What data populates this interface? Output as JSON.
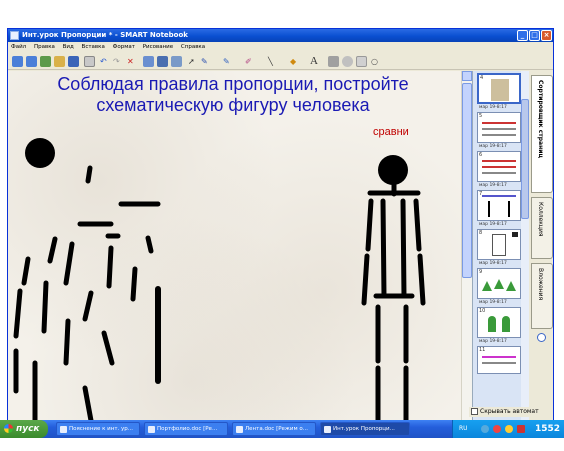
{
  "window": {
    "title": "Инт.урок Пропорции * - SMART Notebook",
    "controls": {
      "minimize": "_",
      "maximize": "□",
      "close": "×"
    }
  },
  "menu": [
    "Файл",
    "Правка",
    "Вид",
    "Вставка",
    "Формат",
    "Рисование",
    "Справка"
  ],
  "toolbar": {
    "icons": [
      "back-icon",
      "forward-icon",
      "add-page-icon",
      "open-icon",
      "save-icon",
      "paste-icon",
      "undo-icon",
      "redo-icon",
      "delete-icon",
      "screen-shade-icon",
      "table-icon",
      "capture-icon",
      "select-icon",
      "pen-icon",
      "creative-pen-icon",
      "eraser-icon",
      "line-icon",
      "fill-icon",
      "text-icon",
      "properties-icon",
      "move-icon",
      "more-icon"
    ]
  },
  "canvas": {
    "heading_line1": "Соблюдая правила пропорции, постройте",
    "heading_line2": "схематическую фигуру человека",
    "compare_label": "сравни",
    "colors": {
      "heading": "#1a1ab4",
      "compare": "#c00000",
      "stroke": "#000000",
      "arrow": "#b01010"
    }
  },
  "sidebar": {
    "thumbnails": [
      {
        "num": "4",
        "date": "мар 19-8:17",
        "selected": true
      },
      {
        "num": "5",
        "date": "мар 19-8:17"
      },
      {
        "num": "6",
        "date": "мар 19-8:17"
      },
      {
        "num": "7",
        "date": "мар 19-8:17"
      },
      {
        "num": "8",
        "date": "мар 19-8:17"
      },
      {
        "num": "9",
        "date": "мар 19-8:17"
      },
      {
        "num": "10",
        "date": "мар 19-8:17"
      },
      {
        "num": "11",
        "date": ""
      }
    ],
    "tabs": [
      "Сортировщик страниц",
      "Коллекция",
      "Вложения"
    ],
    "autohide_label": "Скрывать автомат"
  },
  "taskbar": {
    "start_label": "пуск",
    "tasks": [
      {
        "label": "Пояснение к инт. ур..."
      },
      {
        "label": "Портфолио.doc [Ре..."
      },
      {
        "label": "Лента.doc [Режим о..."
      },
      {
        "label": "Инт.урок Пропорци...",
        "active": true
      }
    ],
    "lang": "RU",
    "clock": "1552"
  }
}
